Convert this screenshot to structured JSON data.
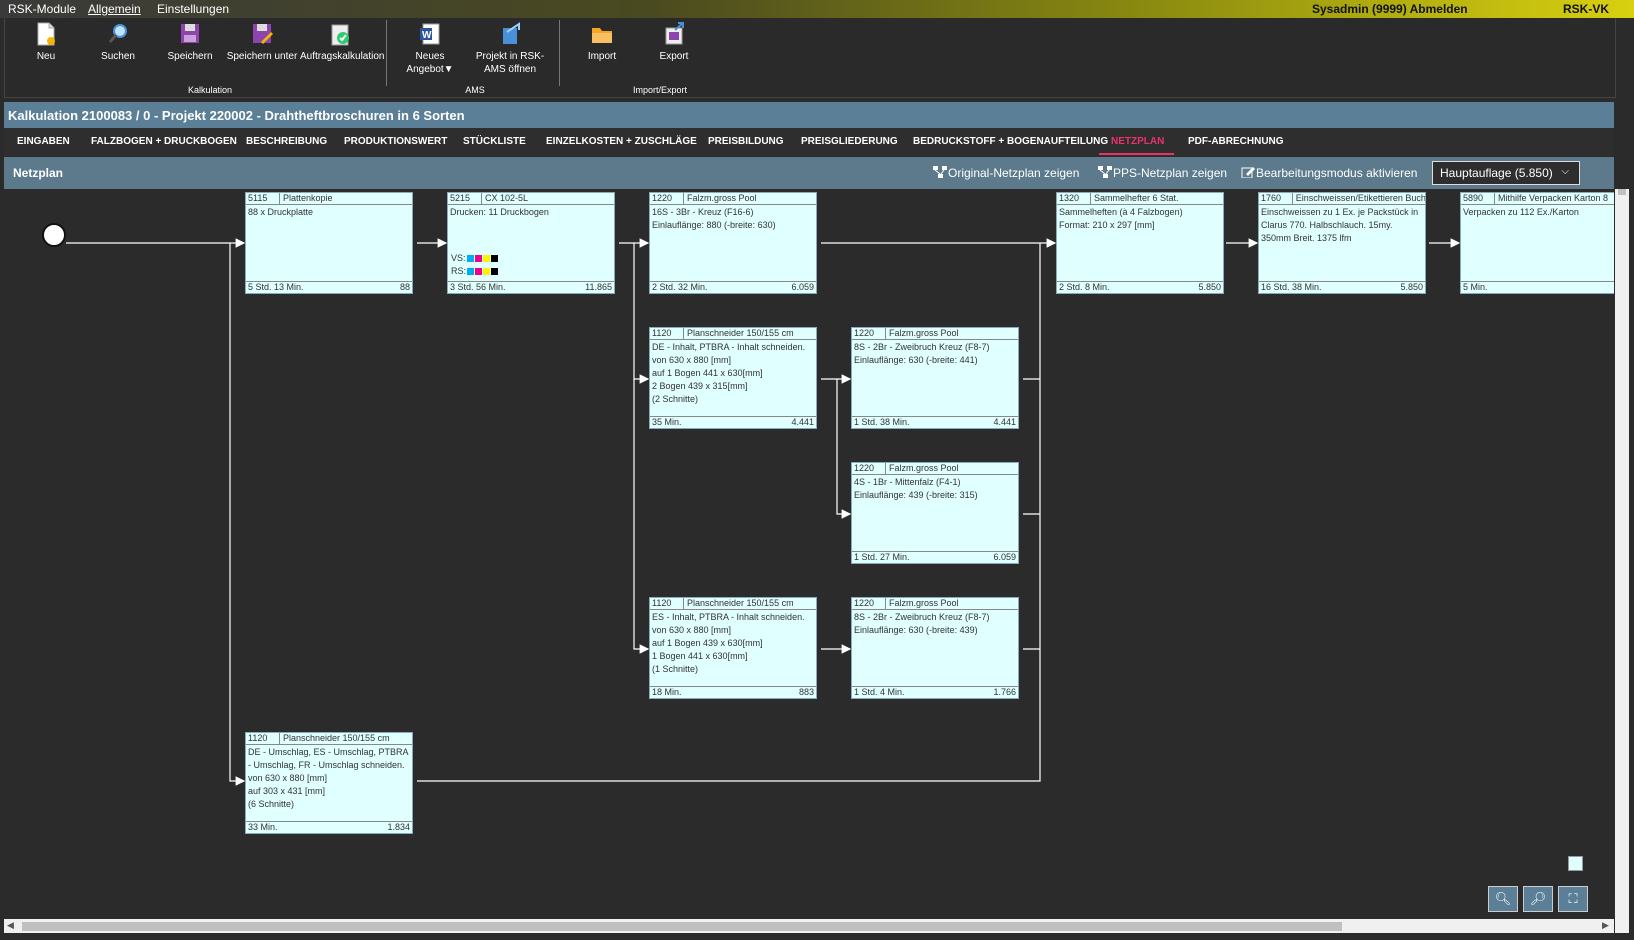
{
  "menubar": {
    "items": [
      "RSK-Module",
      "Allgemein",
      "Einstellungen"
    ],
    "user": "Sysadmin (9999) Abmelden",
    "system": "RSK-VK"
  },
  "ribbon": {
    "buttons": [
      {
        "label": "Neu",
        "icon": "new-document-icon"
      },
      {
        "label": "Suchen",
        "icon": "search-icon"
      },
      {
        "label": "Speichern",
        "icon": "save-icon"
      },
      {
        "label": "Speichern unter",
        "icon": "save-as-icon"
      },
      {
        "label": "Auftragskalkulation",
        "icon": "order-calculation-icon"
      },
      {
        "label": "Neues Angebot▼",
        "icon": "word-document-icon"
      },
      {
        "label": "Projekt in RSK-AMS öffnen",
        "icon": "open-project-icon"
      },
      {
        "label": "Import",
        "icon": "folder-import-icon"
      },
      {
        "label": "Export",
        "icon": "export-icon"
      }
    ],
    "groups": [
      "Kalkulation",
      "AMS",
      "Import/Export"
    ]
  },
  "title": "Kalkulation 2100083 / 0 - Projekt 220002 - Drahtheftbroschuren in 6 Sorten",
  "tabs": [
    "EINGABEN",
    "FALZBOGEN + DRUCKBOGEN",
    "BESCHREIBUNG",
    "PRODUKTIONSWERT",
    "STÜCKLISTE",
    "EINZELKOSTEN + ZUSCHLÄGE",
    "PREISBILDUNG",
    "PREISGLIEDERUNG",
    "BEDRUCKSTOFF + BOGENAUFTEILUNG",
    "NETZPLAN",
    "PDF-ABRECHNUNG"
  ],
  "active_tab": "NETZPLAN",
  "subheader": {
    "title": "Netzplan",
    "btn_original": "Original-Netzplan zeigen",
    "btn_pps": "PPS-Netzplan zeigen",
    "btn_edit": "Bearbeitungsmodus aktivieren",
    "auflage": "Hauptauflage (5.850)"
  },
  "nodes": [
    {
      "code": "5115",
      "name": "Plattenkopie",
      "body": "88 x Druckplatte",
      "time": "5 Std. 13 Min.",
      "qty": "88"
    },
    {
      "code": "5215",
      "name": "CX 102-5L",
      "body": "Drucken: 11 Druckbogen",
      "time": "3 Std. 56 Min.",
      "qty": "11.865",
      "vs": "VS:",
      "rs": "RS:"
    },
    {
      "code": "1220",
      "name": "Falzm.gross Pool",
      "body": "16S - 3Br - Kreuz (F16-6)\nEinlauflänge: 880 (-breite: 630)",
      "time": "2 Std. 32 Min.",
      "qty": "6.059"
    },
    {
      "code": "1320",
      "name": "Sammelhefter 6 Stat.",
      "body": "Sammelheften (à 4 Falzbogen)\nFormat: 210 x 297 [mm]",
      "time": "2 Std. 8 Min.",
      "qty": "5.850"
    },
    {
      "code": "1760",
      "name": "Einschweissen/Etikettieren Buch",
      "body": "Einschweissen zu 1 Ex. je Packstück in Clarus 770. Halbschlauch. 15my. 350mm Breit. 1375 lfm",
      "time": "16 Std. 38 Min.",
      "qty": "5.850"
    },
    {
      "code": "5890",
      "name": "Mithilfe Verpacken Karton 8",
      "body": "Verpacken zu 112 Ex./Karton",
      "time": "5 Min.",
      "qty": ""
    },
    {
      "code": "1120",
      "name": "Planschneider 150/155 cm",
      "body": "DE - Inhalt, PTBRA - Inhalt schneiden.\nvon 630 x 880 [mm]\nauf 1 Bogen 441 x 630[mm]\n2 Bogen 439 x 315[mm]\n(2 Schnitte)",
      "time": "35 Min.",
      "qty": "4.441"
    },
    {
      "code": "1220",
      "name": "Falzm.gross Pool",
      "body": "8S - 2Br - Zweibruch Kreuz (F8-7)\nEinlauflänge: 630 (-breite: 441)",
      "time": "1 Std. 38 Min.",
      "qty": "4.441"
    },
    {
      "code": "1220",
      "name": "Falzm.gross Pool",
      "body": "4S - 1Br - Mittenfalz (F4-1)\nEinlauflänge: 439 (-breite: 315)",
      "time": "1 Std. 27 Min.",
      "qty": "6.059"
    },
    {
      "code": "1120",
      "name": "Planschneider 150/155 cm",
      "body": "ES - Inhalt, PTBRA - Inhalt schneiden.\nvon 630 x 880 [mm]\nauf 1 Bogen 439 x 630[mm]\n1 Bogen 441 x 630[mm]\n(1 Schnitte)",
      "time": "18 Min.",
      "qty": "883"
    },
    {
      "code": "1220",
      "name": "Falzm.gross Pool",
      "body": "8S - 2Br - Zweibruch Kreuz (F8-7)\nEinlauflänge: 630 (-breite: 439)",
      "time": "1 Std. 4 Min.",
      "qty": "1.766"
    },
    {
      "code": "1120",
      "name": "Planschneider 150/155 cm",
      "body": "DE - Umschlag, ES - Umschlag, PTBRA - Umschlag, FR - Umschlag schneiden.\nvon 630 x 880 [mm]\nauf 303 x 431 [mm]\n(6 Schnitte)",
      "time": "33 Min.",
      "qty": "1.834"
    }
  ],
  "colors": {
    "accent": "#e8336a",
    "titlebar": "#5a7f96",
    "node_bg": "#e0ffff"
  }
}
